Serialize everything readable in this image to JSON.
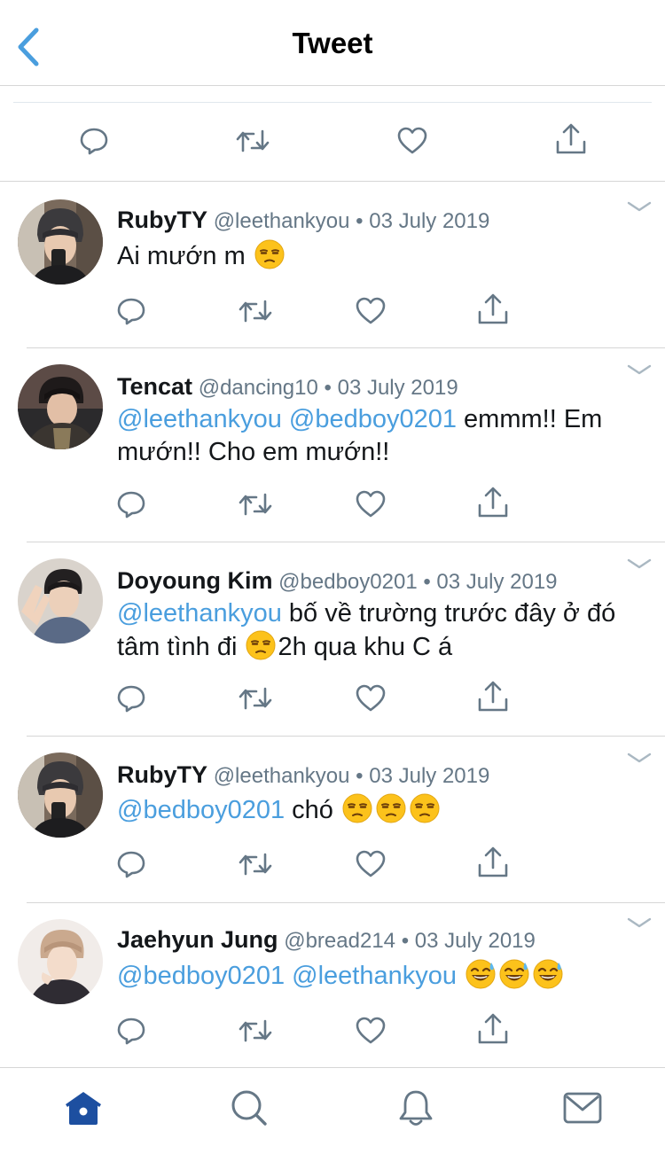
{
  "header": {
    "title": "Tweet"
  },
  "main_actions": [
    "reply-icon",
    "retweet-icon",
    "like-icon",
    "share-icon"
  ],
  "replies": [
    {
      "name": "RubyTY",
      "handle": "@leethankyou",
      "date": "03 July 2019",
      "avatar": "avatar-rubyty",
      "text_parts": [
        {
          "type": "text",
          "value": "Ai mướn m "
        },
        {
          "type": "emoji",
          "value": "unamused-face"
        }
      ]
    },
    {
      "name": "Tencat",
      "handle": "@dancing10",
      "date": "03 July 2019",
      "avatar": "avatar-tencat",
      "text_line1_mentions": "@leethankyou @bedboy0201",
      "text_line1_rest": " emmm!! Em",
      "text_line2": "mướn!! Cho em mướn!!"
    },
    {
      "name": "Doyoung Kim",
      "handle": "@bedboy0201",
      "date": "03 July 2019",
      "avatar": "avatar-doyoung",
      "text_line1_mention": "@leethankyou",
      "text_line1_rest": " bố về trường trước đây ở đó",
      "text_line2_a": "tâm tình đi ",
      "text_line2_b": "2h qua khu C á"
    },
    {
      "name": "RubyTY",
      "handle": "@leethankyou",
      "date": "03 July 2019",
      "avatar": "avatar-rubyty",
      "text_mention": "@bedboy0201",
      "text_rest": " chó "
    },
    {
      "name": "Jaehyun Jung",
      "handle": "@bread214",
      "date": "03 July 2019",
      "avatar": "avatar-jaehyun",
      "text_mentions": "@bedboy0201 @leethankyou",
      "text_rest": " "
    }
  ],
  "dot": "•",
  "tabbar": {
    "items": [
      "home-icon",
      "search-icon",
      "notifications-icon",
      "messages-icon"
    ],
    "active": "home-icon"
  },
  "colors": {
    "accent": "#4a9ede",
    "secondary_text": "#657786",
    "icon_gray": "#657786",
    "home_active": "#1d4fa0"
  }
}
